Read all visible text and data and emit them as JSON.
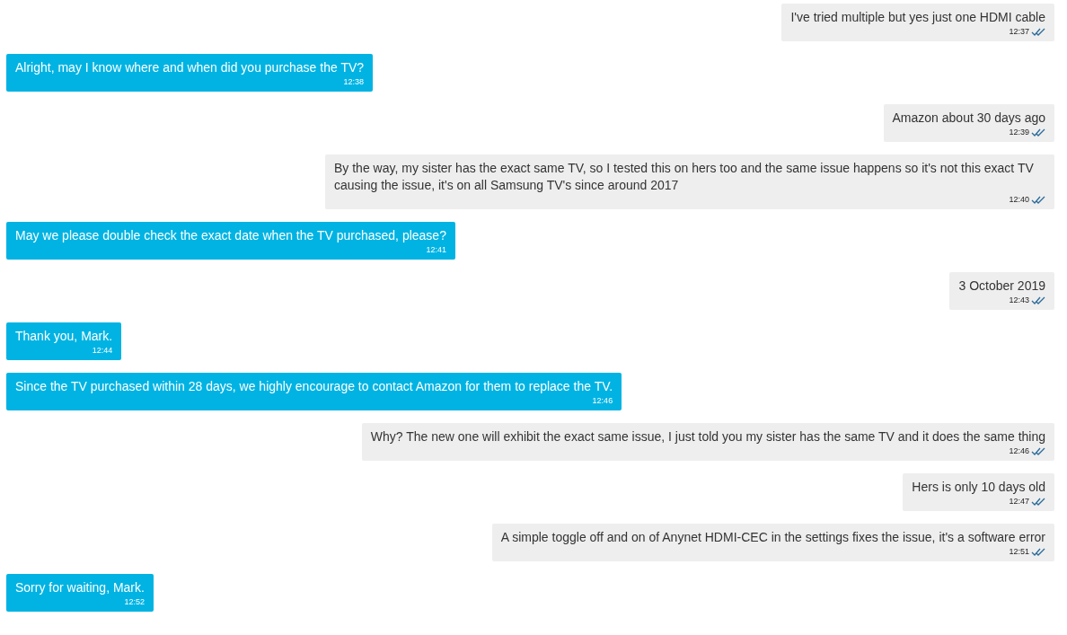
{
  "messages": [
    {
      "kind": "sent",
      "text": "I've tried multiple but yes just one HDMI cable",
      "time": "12:37",
      "read": true
    },
    {
      "kind": "received",
      "text": "Alright, may I know where and when did you purchase the TV?",
      "time": "12:38"
    },
    {
      "kind": "sent",
      "text": "Amazon about 30 days ago",
      "time": "12:39",
      "read": true
    },
    {
      "kind": "sent",
      "text": "By the way, my sister has the exact same TV, so I tested this on hers too and the same issue happens so it's not this exact TV causing the issue, it's on all Samsung TV's since around 2017",
      "time": "12:40",
      "read": true
    },
    {
      "kind": "received",
      "text": "May we please double check the exact date when the TV purchased, please?",
      "time": "12:41"
    },
    {
      "kind": "sent",
      "text": "3 October 2019",
      "time": "12:43",
      "read": true
    },
    {
      "kind": "received",
      "text": "Thank you, Mark.",
      "time": "12:44"
    },
    {
      "kind": "received",
      "text": "Since the TV purchased within 28 days, we highly encourage to contact Amazon for them to replace the TV.",
      "time": "12:46"
    },
    {
      "kind": "sent",
      "text": "Why? The new one will exhibit the exact same issue, I just told you my sister has the same TV and it does the same thing",
      "time": "12:46",
      "read": true
    },
    {
      "kind": "sent",
      "text": "Hers is only 10 days old",
      "time": "12:47",
      "read": true
    },
    {
      "kind": "sent",
      "text": "A simple toggle off and on of Anynet HDMI-CEC in the settings fixes the issue, it's a software error",
      "time": "12:51",
      "read": true
    },
    {
      "kind": "received",
      "text": "Sorry for waiting, Mark.",
      "time": "12:52"
    }
  ]
}
